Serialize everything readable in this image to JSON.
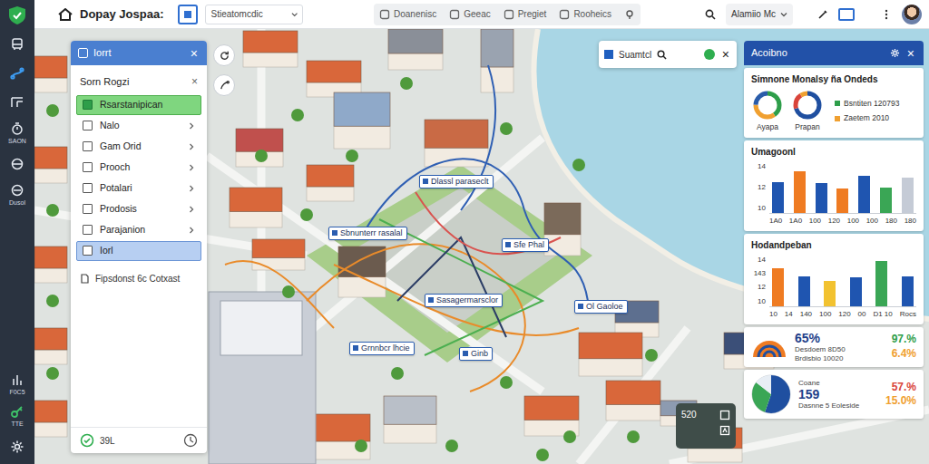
{
  "topbar": {
    "title": "Dopay Jospaa:",
    "search_value": "Stieatomcdic",
    "buttons": [
      "Doanenisc",
      "Geeac",
      "Pregiet",
      "Rooheics"
    ],
    "user": "Alamiio Mc"
  },
  "rail": {
    "labels": [
      "SAON",
      "Dusol",
      "F0C5",
      "TTE"
    ]
  },
  "layers": {
    "title": "Iorrt",
    "close": "×",
    "subtitle": "Sorn Rogzi",
    "subtitle_close": "×",
    "items": [
      {
        "label": "Rsarstanipican",
        "checked": true,
        "selected": false
      },
      {
        "label": "Nalo",
        "checked": false,
        "selected": false
      },
      {
        "label": "Gam Orid",
        "checked": false,
        "selected": false
      },
      {
        "label": "Prooch",
        "checked": false,
        "selected": false
      },
      {
        "label": "Potalari",
        "checked": false,
        "selected": false
      },
      {
        "label": "Prodosis",
        "checked": false,
        "selected": false
      },
      {
        "label": "Parajanion",
        "checked": false,
        "selected": false
      },
      {
        "label": "Iorl",
        "checked": false,
        "selected": true
      }
    ],
    "footer_link": "Fipsdonst 6c Cotxast",
    "status": "39L"
  },
  "map": {
    "search": {
      "value": "Suamtcl",
      "close": "×"
    },
    "labels": [
      "Dlassl paraseclt",
      "Sbnunterr rasalal",
      "Sfe Phal",
      "Sasagermarsclor",
      "Ol Gaoloe",
      "Grnnbcr lhcie",
      "Ginb"
    ],
    "counter": "520"
  },
  "analytics": {
    "title": "Acoibno",
    "close": "×",
    "donut_card": {
      "title": "Simnone Monalsy ña Ondeds",
      "donuts": [
        {
          "label": "Ayapa",
          "segments": [
            {
              "value": 40,
              "color": "#2e9e4a"
            },
            {
              "value": 35,
              "color": "#f0a030"
            },
            {
              "value": 25,
              "color": "#2a5caa"
            }
          ]
        },
        {
          "label": "Prapan",
          "segments": [
            {
              "value": 70,
              "color": "#1f4fa0"
            },
            {
              "value": 20,
              "color": "#d9443a"
            },
            {
              "value": 10,
              "color": "#f0a030"
            }
          ]
        }
      ],
      "legend": [
        {
          "text": "Bsntiten 120793",
          "color": "#2e9e4a"
        },
        {
          "text": "Zaetem 2010",
          "color": "#f0a030"
        }
      ]
    },
    "bar_charts": [
      {
        "title": "Umagoonl",
        "ticks": [
          "14",
          "12",
          "10"
        ],
        "bars": [
          {
            "value": 12.6,
            "color": "#1f55b0"
          },
          {
            "value": 13.8,
            "color": "#ef7b22"
          },
          {
            "value": 12.4,
            "color": "#1f55b0"
          },
          {
            "value": 11.8,
            "color": "#ef7b22"
          },
          {
            "value": 13.3,
            "color": "#1f55b0"
          },
          {
            "value": 11.9,
            "color": "#3aa655"
          },
          {
            "value": 13.1,
            "color": "#c5cbd6"
          }
        ],
        "x_labels": [
          "1A0",
          "1A0",
          "100",
          "120",
          "100",
          "100",
          "180",
          "180"
        ]
      },
      {
        "title": "Hodandpeban",
        "ticks": [
          "14",
          "143",
          "12",
          "10"
        ],
        "bars": [
          {
            "value": 13.4,
            "color": "#ef7b22"
          },
          {
            "value": 12.4,
            "color": "#1f55b0"
          },
          {
            "value": 11.9,
            "color": "#f2c230"
          },
          {
            "value": 12.3,
            "color": "#1f55b0"
          },
          {
            "value": 14.2,
            "color": "#3aa655"
          },
          {
            "value": 12.4,
            "color": "#1f55b0"
          }
        ],
        "x_labels": [
          "10",
          "14",
          "140",
          "100",
          "120",
          "00",
          "D1 10",
          "Rocs"
        ]
      }
    ],
    "stat": {
      "value": "65%",
      "lines": [
        "Desdoem 8D50",
        "Brdisbio 10020"
      ],
      "right": [
        {
          "text": "97.%",
          "color": "#2e9e4a"
        },
        {
          "text": "6.4%",
          "color": "#f0a030"
        }
      ]
    },
    "pie": {
      "title": "Coane",
      "value": "159",
      "line": "Dasnne 5 Eoleside",
      "slices": [
        {
          "value": 55,
          "color": "#1f4fa0"
        },
        {
          "value": 30,
          "color": "#3aa655"
        },
        {
          "value": 15,
          "color": "#e8eef5"
        }
      ],
      "right": [
        {
          "text": "57.%",
          "color": "#d9443a"
        },
        {
          "text": "15.0%",
          "color": "#f0a030"
        }
      ]
    }
  }
}
